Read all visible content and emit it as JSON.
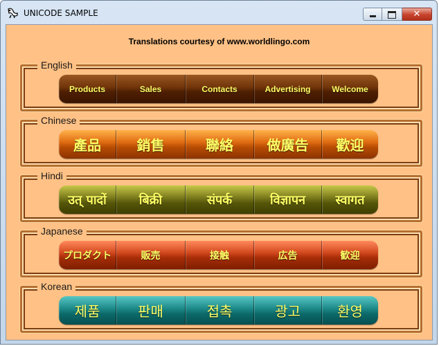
{
  "window": {
    "title": "UNICODE SAMPLE",
    "controls": {
      "minimize": "minimize",
      "maximize": "maximize",
      "close": "✕"
    }
  },
  "credit": "Translations courtesy of www.worldlingo.com",
  "groups": [
    {
      "legend": "English",
      "items": [
        "Products",
        "Sales",
        "Contacts",
        "Advertising",
        "Welcome"
      ]
    },
    {
      "legend": "Chinese",
      "items": [
        "產品",
        "銷售",
        "聯絡",
        "做廣告",
        "歡迎"
      ]
    },
    {
      "legend": "Hindi",
      "items": [
        "उत् पादों",
        "बिक्री",
        "संपर्क",
        "विज्ञापन",
        "स्वागत"
      ]
    },
    {
      "legend": "Japanese",
      "items": [
        "プロダクト",
        "販売",
        "接触",
        "広告",
        "歓迎"
      ]
    },
    {
      "legend": "Korean",
      "items": [
        "제품",
        "판매",
        "접촉",
        "광고",
        "환영"
      ]
    }
  ],
  "colors": {
    "client_background": "#ffc185",
    "label_text": "#ffff66",
    "english_bar": "#6f3409",
    "chinese_bar": "#e06d12",
    "hindi_bar": "#7d7d1d",
    "japanese_bar": "#d2481e",
    "korean_bar": "#1f8c8b"
  }
}
